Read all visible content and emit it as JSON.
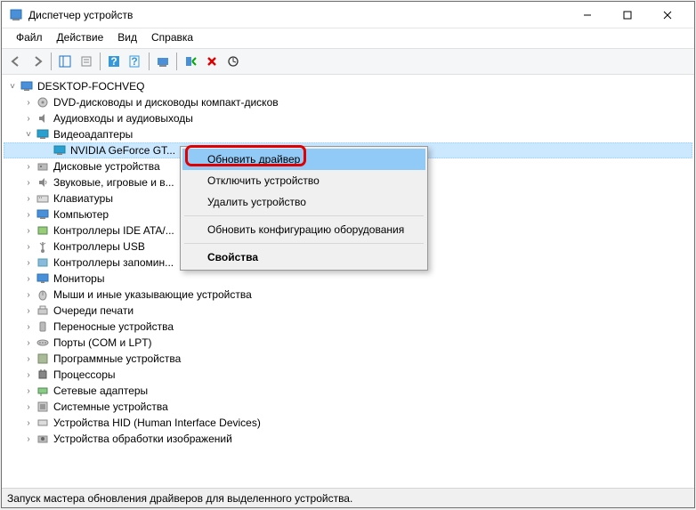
{
  "title": "Диспетчер устройств",
  "menu": {
    "file": "Файл",
    "action": "Действие",
    "view": "Вид",
    "help": "Справка"
  },
  "tree": {
    "root": "DESKTOP-FOCHVEQ",
    "items": [
      {
        "label": "DVD-дисководы и дисководы компакт-дисков",
        "expanded": false
      },
      {
        "label": "Аудиовходы и аудиовыходы",
        "expanded": false
      },
      {
        "label": "Видеоадаптеры",
        "expanded": true,
        "children": [
          {
            "label": "NVIDIA GeForce GT..."
          }
        ]
      },
      {
        "label": "Дисковые устройства",
        "expanded": false
      },
      {
        "label": "Звуковые, игровые и в...",
        "expanded": false
      },
      {
        "label": "Клавиатуры",
        "expanded": false
      },
      {
        "label": "Компьютер",
        "expanded": false
      },
      {
        "label": "Контроллеры IDE ATA/...",
        "expanded": false
      },
      {
        "label": "Контроллеры USB",
        "expanded": false
      },
      {
        "label": "Контроллеры запомин...",
        "expanded": false
      },
      {
        "label": "Мониторы",
        "expanded": false
      },
      {
        "label": "Мыши и иные указывающие устройства",
        "expanded": false
      },
      {
        "label": "Очереди печати",
        "expanded": false
      },
      {
        "label": "Переносные устройства",
        "expanded": false
      },
      {
        "label": "Порты (COM и LPT)",
        "expanded": false
      },
      {
        "label": "Программные устройства",
        "expanded": false
      },
      {
        "label": "Процессоры",
        "expanded": false
      },
      {
        "label": "Сетевые адаптеры",
        "expanded": false
      },
      {
        "label": "Системные устройства",
        "expanded": false
      },
      {
        "label": "Устройства HID (Human Interface Devices)",
        "expanded": false
      },
      {
        "label": "Устройства обработки изображений",
        "expanded": false
      }
    ]
  },
  "context_menu": {
    "update_driver": "Обновить драйвер",
    "disable_device": "Отключить устройство",
    "remove_device": "Удалить устройство",
    "scan_hardware": "Обновить конфигурацию оборудования",
    "properties": "Свойства"
  },
  "status": "Запуск мастера обновления драйверов для выделенного устройства."
}
